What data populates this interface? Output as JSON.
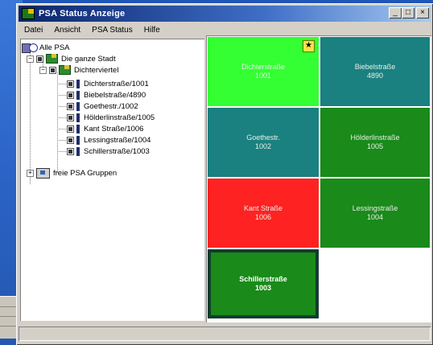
{
  "window": {
    "title": "PSA Status Anzeige"
  },
  "window_buttons": [
    "_",
    "□",
    "×"
  ],
  "menu": [
    "Datei",
    "Ansicht",
    "PSA Status",
    "Hilfe"
  ],
  "tree": {
    "root": "Alle PSA",
    "group": "Die ganze Stadt",
    "subgroup": "Dichterviertel",
    "items": [
      "Dichterstraße/1001",
      "Biebelstraße/4890",
      "Goethestr./1002",
      "Hölderlinstraße/1005",
      "Kant Straße/1006",
      "Lessingstraße/1004",
      "Schillerstraße/1003"
    ],
    "free": "freie PSA Gruppen"
  },
  "tiles": [
    {
      "name": "Dichterstraße",
      "id": "1001",
      "color": "#33ff33",
      "badge": "★"
    },
    {
      "name": "Biebelstraße",
      "id": "4890",
      "color": "#1a8080"
    },
    {
      "name": "Goethestr.",
      "id": "1002",
      "color": "#1a8080"
    },
    {
      "name": "Hölderlinstraße",
      "id": "1005",
      "color": "#1a8a1a"
    },
    {
      "name": "Kant Straße",
      "id": "1006",
      "color": "#ff2222"
    },
    {
      "name": "Lessingstraße",
      "id": "1004",
      "color": "#1a8a1a"
    },
    {
      "name": "Schillerstraße",
      "id": "1003",
      "color": "#1a8a1a",
      "selected": true
    }
  ]
}
